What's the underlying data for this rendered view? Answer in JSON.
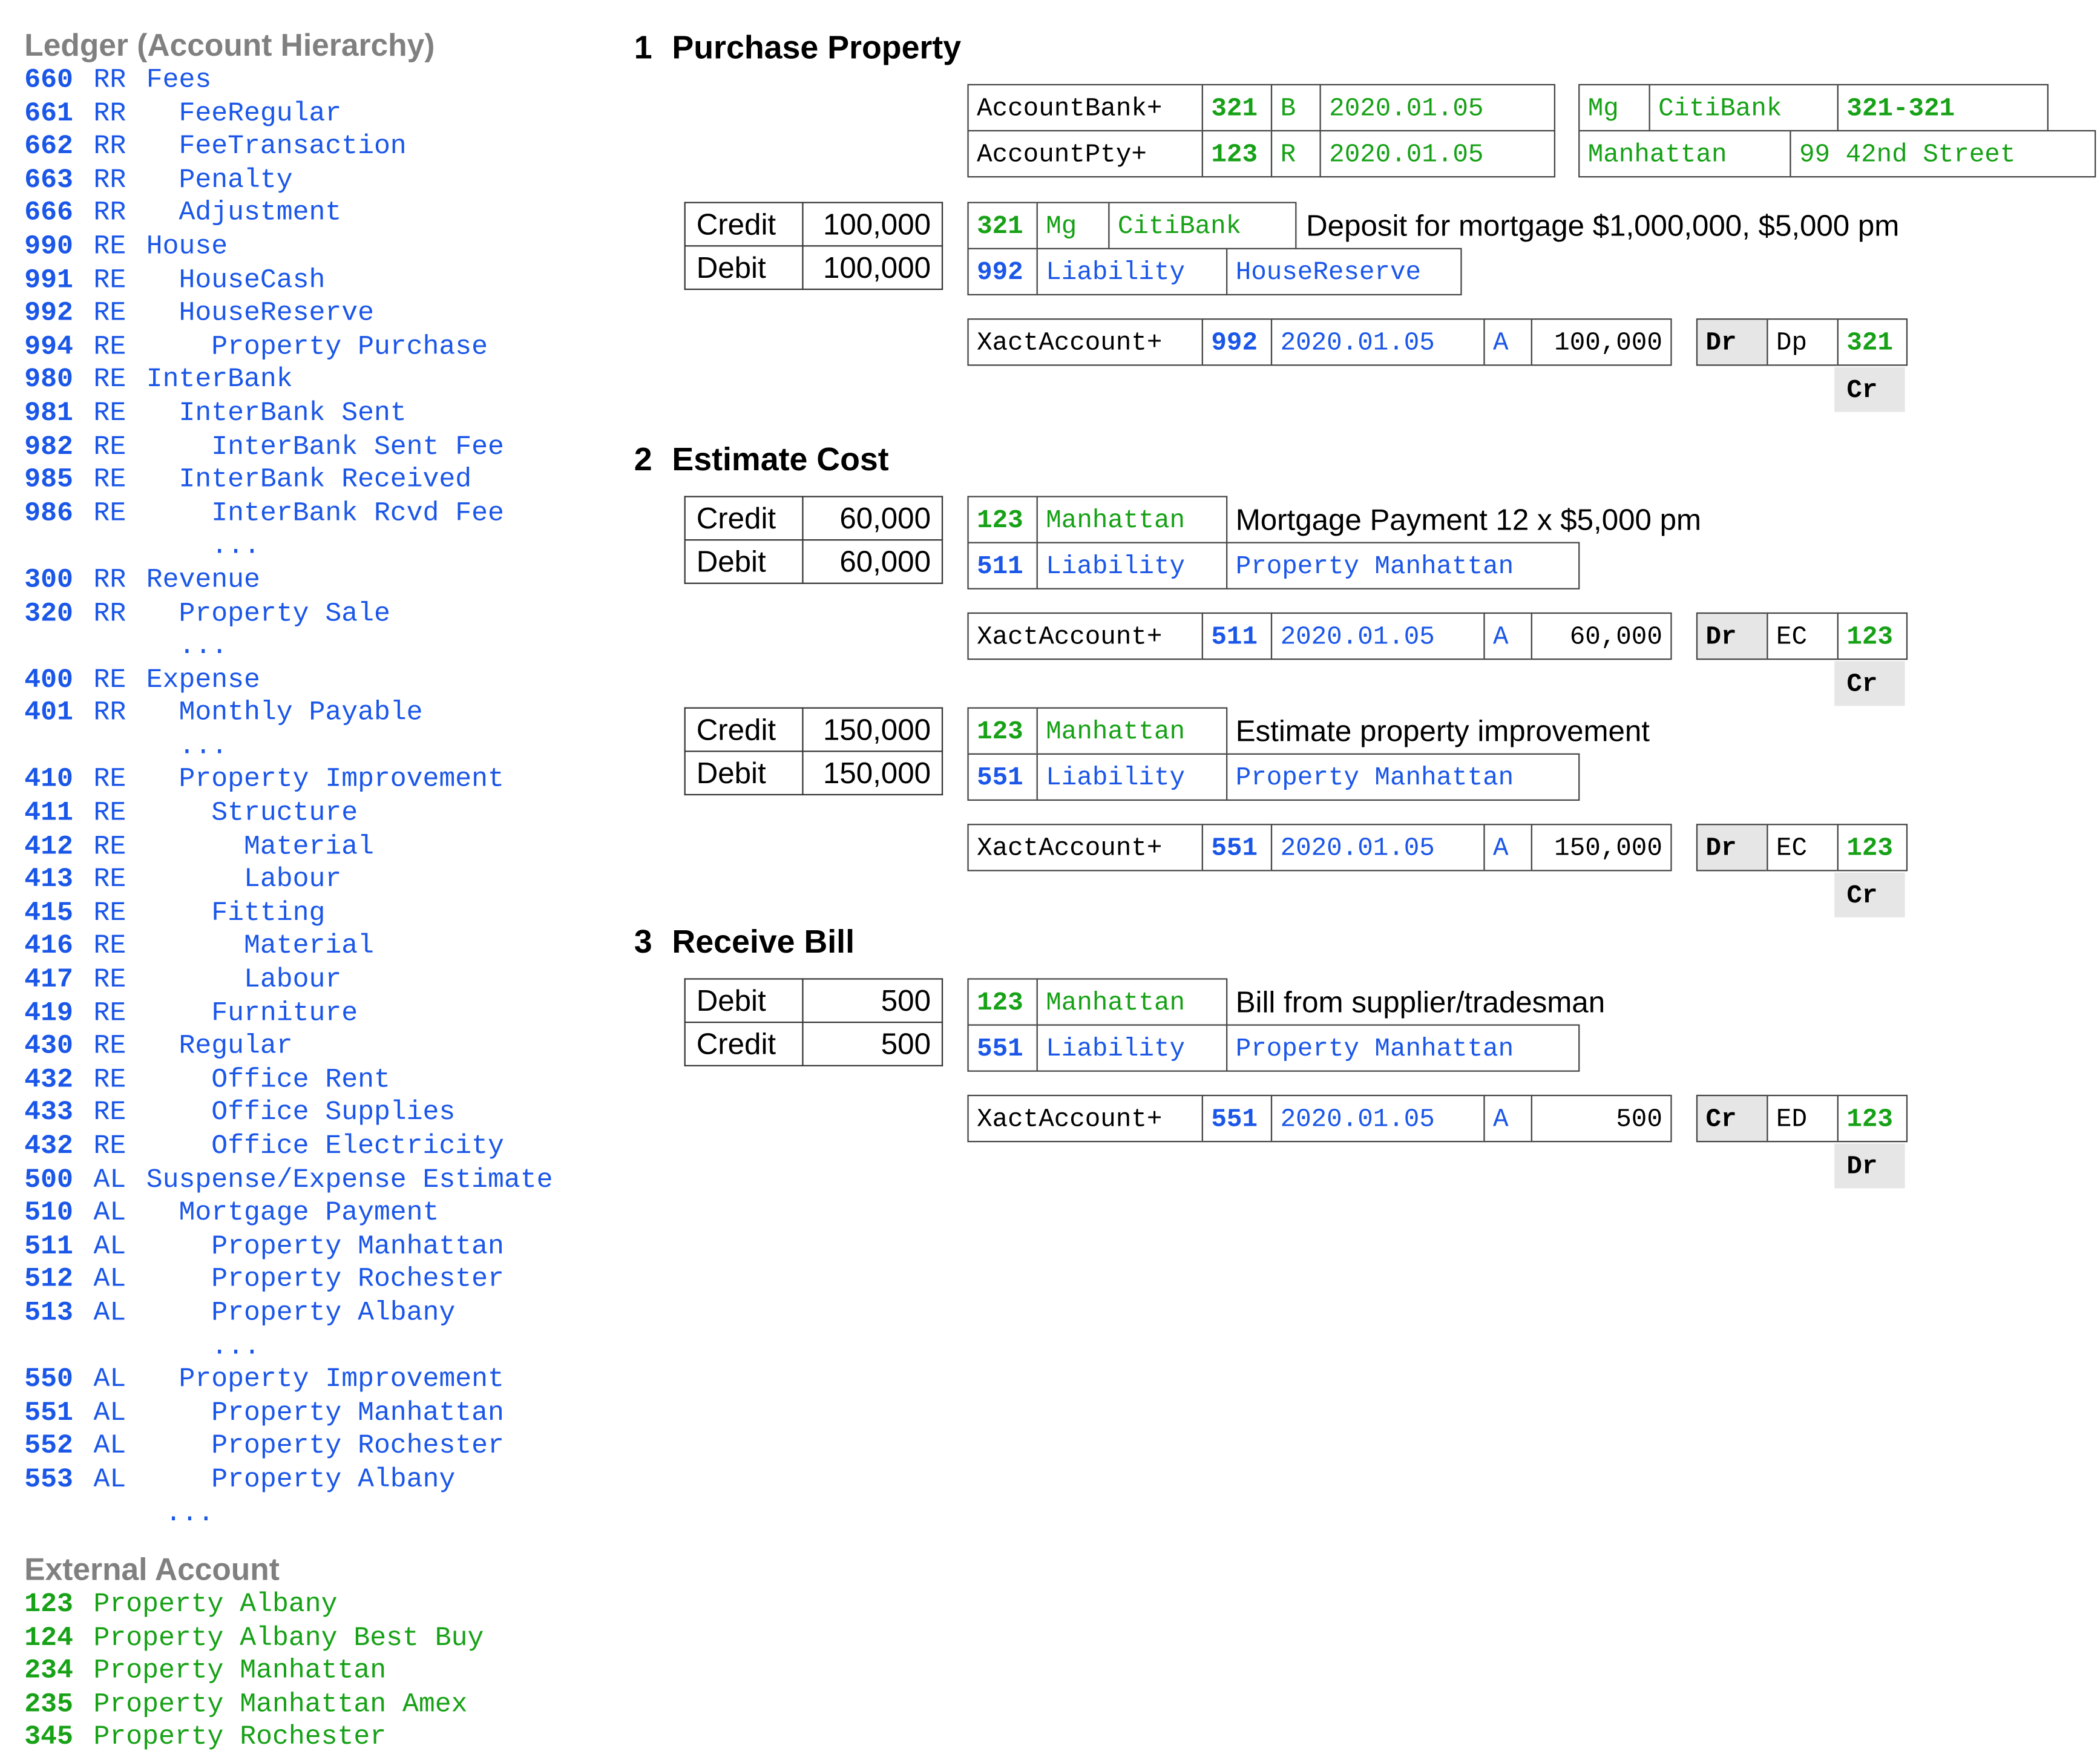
{
  "ledger": {
    "heading": "Ledger (Account Hierarchy)",
    "rows": [
      {
        "code": "660",
        "type": "RR",
        "name": "Fees"
      },
      {
        "code": "661",
        "type": "RR",
        "name": "  FeeRegular"
      },
      {
        "code": "662",
        "type": "RR",
        "name": "  FeeTransaction"
      },
      {
        "code": "663",
        "type": "RR",
        "name": "  Penalty"
      },
      {
        "code": "666",
        "type": "RR",
        "name": "  Adjustment"
      },
      {
        "code": "990",
        "type": "RE",
        "name": "House"
      },
      {
        "code": "991",
        "type": "RE",
        "name": "  HouseCash"
      },
      {
        "code": "992",
        "type": "RE",
        "name": "  HouseReserve"
      },
      {
        "code": "994",
        "type": "RE",
        "name": "    Property Purchase"
      },
      {
        "code": "980",
        "type": "RE",
        "name": "InterBank"
      },
      {
        "code": "981",
        "type": "RE",
        "name": "  InterBank Sent"
      },
      {
        "code": "982",
        "type": "RE",
        "name": "    InterBank Sent Fee"
      },
      {
        "code": "985",
        "type": "RE",
        "name": "  InterBank Received"
      },
      {
        "code": "986",
        "type": "RE",
        "name": "    InterBank Rcvd Fee"
      },
      {
        "code": "",
        "type": "",
        "name": "    ..."
      },
      {
        "code": "300",
        "type": "RR",
        "name": "Revenue"
      },
      {
        "code": "320",
        "type": "RR",
        "name": "  Property Sale"
      },
      {
        "code": "",
        "type": "",
        "name": "  ..."
      },
      {
        "code": "400",
        "type": "RE",
        "name": "Expense"
      },
      {
        "code": "401",
        "type": "RR",
        "name": "  Monthly Payable"
      },
      {
        "code": "",
        "type": "",
        "name": "  ..."
      },
      {
        "code": "410",
        "type": "RE",
        "name": "  Property Improvement"
      },
      {
        "code": "411",
        "type": "RE",
        "name": "    Structure"
      },
      {
        "code": "412",
        "type": "RE",
        "name": "      Material"
      },
      {
        "code": "413",
        "type": "RE",
        "name": "      Labour"
      },
      {
        "code": "415",
        "type": "RE",
        "name": "    Fitting"
      },
      {
        "code": "416",
        "type": "RE",
        "name": "      Material"
      },
      {
        "code": "417",
        "type": "RE",
        "name": "      Labour"
      },
      {
        "code": "419",
        "type": "RE",
        "name": "    Furniture"
      },
      {
        "code": "430",
        "type": "RE",
        "name": "  Regular"
      },
      {
        "code": "432",
        "type": "RE",
        "name": "    Office Rent"
      },
      {
        "code": "433",
        "type": "RE",
        "name": "    Office Supplies"
      },
      {
        "code": "432",
        "type": "RE",
        "name": "    Office Electricity"
      },
      {
        "code": "500",
        "type": "AL",
        "name": "Suspense/Expense Estimate"
      },
      {
        "code": "510",
        "type": "AL",
        "name": "  Mortgage Payment"
      },
      {
        "code": "511",
        "type": "AL",
        "name": "    Property Manhattan"
      },
      {
        "code": "512",
        "type": "AL",
        "name": "    Property Rochester"
      },
      {
        "code": "513",
        "type": "AL",
        "name": "    Property Albany"
      },
      {
        "code": "",
        "type": "",
        "name": "    ..."
      },
      {
        "code": "550",
        "type": "AL",
        "name": "  Property Improvement"
      },
      {
        "code": "551",
        "type": "AL",
        "name": "    Property Manhattan"
      },
      {
        "code": "552",
        "type": "AL",
        "name": "    Property Rochester"
      },
      {
        "code": "553",
        "type": "AL",
        "name": "    Property Albany"
      },
      {
        "code": "",
        "type": "",
        "name": "..."
      }
    ]
  },
  "external": {
    "heading": "External Account",
    "rows": [
      {
        "code": "123",
        "name": "Property Albany"
      },
      {
        "code": "124",
        "name": "Property Albany Best Buy"
      },
      {
        "code": "234",
        "name": "Property Manhattan"
      },
      {
        "code": "235",
        "name": "Property Manhattan Amex"
      },
      {
        "code": "345",
        "name": "Property Rochester"
      }
    ]
  },
  "sections": {
    "s1": {
      "num": "1",
      "title": "Purchase Property",
      "account_bank": {
        "label": "AccountBank+",
        "code": "321",
        "type": "B",
        "date": "2020.01.05"
      },
      "account_pty": {
        "label": "AccountPty+",
        "code": "123",
        "type": "R",
        "date": "2020.01.05"
      },
      "bank_info": {
        "mg": "Mg",
        "bank": "CitiBank",
        "acct": "321-321"
      },
      "addr_info": {
        "city": "Manhattan",
        "street": "99 42nd Street"
      },
      "credit_label": "Credit",
      "credit_amount": "100,000",
      "debit_label": "Debit",
      "debit_amount": "100,000",
      "ext": {
        "code": "321",
        "type": "Mg",
        "name": "CitiBank"
      },
      "ledger_acct": {
        "code": "992",
        "type": "Liability",
        "name": "HouseReserve"
      },
      "description": "Deposit for mortgage $1,000,000, $5,000 pm",
      "xact": {
        "label": "XactAccount+",
        "code": "992",
        "date": "2020.01.05",
        "flag": "A",
        "amount": "100,000",
        "dir": "Dr",
        "kind": "Dp",
        "ext_code": "321",
        "contra": "Cr"
      }
    },
    "s2": {
      "num": "2",
      "title": "Estimate Cost",
      "a": {
        "credit_label": "Credit",
        "credit_amount": "60,000",
        "debit_label": "Debit",
        "debit_amount": "60,000",
        "ext": {
          "code": "123",
          "name": "Manhattan"
        },
        "ledger_acct": {
          "code": "511",
          "type": "Liability",
          "name": "Property Manhattan"
        },
        "description": "Mortgage Payment 12 x $5,000 pm",
        "xact": {
          "label": "XactAccount+",
          "code": "511",
          "date": "2020.01.05",
          "flag": "A",
          "amount": "60,000",
          "dir": "Dr",
          "kind": "EC",
          "ext_code": "123",
          "contra": "Cr"
        }
      },
      "b": {
        "credit_label": "Credit",
        "credit_amount": "150,000",
        "debit_label": "Debit",
        "debit_amount": "150,000",
        "ext": {
          "code": "123",
          "name": "Manhattan"
        },
        "ledger_acct": {
          "code": "551",
          "type": "Liability",
          "name": "Property Manhattan"
        },
        "description": "Estimate property improvement",
        "xact": {
          "label": "XactAccount+",
          "code": "551",
          "date": "2020.01.05",
          "flag": "A",
          "amount": "150,000",
          "dir": "Dr",
          "kind": "EC",
          "ext_code": "123",
          "contra": "Cr"
        }
      }
    },
    "s3": {
      "num": "3",
      "title": "Receive Bill",
      "debit_label": "Debit",
      "debit_amount": "500",
      "credit_label": "Credit",
      "credit_amount": "500",
      "ext": {
        "code": "123",
        "name": "Manhattan"
      },
      "ledger_acct": {
        "code": "551",
        "type": "Liability",
        "name": "Property Manhattan"
      },
      "description": "Bill from supplier/tradesman",
      "xact": {
        "label": "XactAccount+",
        "code": "551",
        "date": "2020.01.05",
        "flag": "A",
        "amount": "500",
        "dir": "Cr",
        "kind": "ED",
        "ext_code": "123",
        "contra": "Dr"
      }
    }
  }
}
